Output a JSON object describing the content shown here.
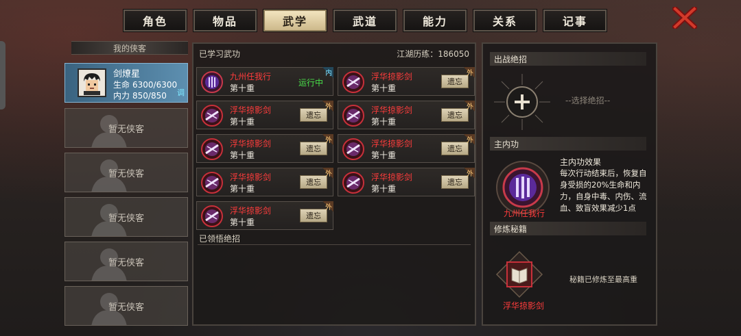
{
  "tabs": [
    {
      "label": "角色",
      "active": false
    },
    {
      "label": "物品",
      "active": false
    },
    {
      "label": "武学",
      "active": true
    },
    {
      "label": "武道",
      "active": false
    },
    {
      "label": "能力",
      "active": false
    },
    {
      "label": "关系",
      "active": false
    },
    {
      "label": "记事",
      "active": false
    }
  ],
  "close_icon": "close-x-icon",
  "left": {
    "section_label": "我的侠客",
    "hero": {
      "name": "剑燎星",
      "hp_label": "生命",
      "hp_value": "6300/6300",
      "mp_label": "内力",
      "mp_value": "850/850",
      "tune_label": "调"
    },
    "empty_slots": [
      "暂无侠客",
      "暂无侠客",
      "暂无侠客",
      "暂无侠客",
      "暂无侠客"
    ]
  },
  "middle": {
    "learned_label": "已学习武功",
    "exp_label": "江湖历练：186050",
    "skills": [
      {
        "name": "九州任我行",
        "level": "第十重",
        "status": "运行中",
        "tag": "内"
      },
      {
        "name": "浮华掠影剑",
        "level": "第十重",
        "button": "遗忘",
        "tag": "外"
      },
      {
        "name": "浮华掠影剑",
        "level": "第十重",
        "button": "遗忘",
        "tag": "外"
      },
      {
        "name": "浮华掠影剑",
        "level": "第十重",
        "button": "遗忘",
        "tag": "外"
      },
      {
        "name": "浮华掠影剑",
        "level": "第十重",
        "button": "遗忘",
        "tag": "外"
      },
      {
        "name": "浮华掠影剑",
        "level": "第十重",
        "button": "遗忘",
        "tag": "外"
      },
      {
        "name": "浮华掠影剑",
        "level": "第十重",
        "button": "遗忘",
        "tag": "外"
      },
      {
        "name": "浮华掠影剑",
        "level": "第十重",
        "button": "遗忘",
        "tag": "外"
      },
      {
        "name": "浮华掠影剑",
        "level": "第十重",
        "button": "遗忘",
        "tag": "外"
      }
    ],
    "comprehended_label": "已领悟绝招"
  },
  "right": {
    "ultimate_label": "出战绝招",
    "ultimate_hint": "--选择绝招--",
    "main_inner_label": "主内功",
    "main_inner_name": "九州任我行",
    "effect_title": "主内功效果",
    "effect_text": "每次行动结束后，恢复自身受损的20%生命和内力，自身中毒、内伤、流血、致盲效果减少1点",
    "training_label": "修炼秘籍",
    "book_name": "浮华掠影剑",
    "book_status": "秘籍已修炼至最高重"
  }
}
